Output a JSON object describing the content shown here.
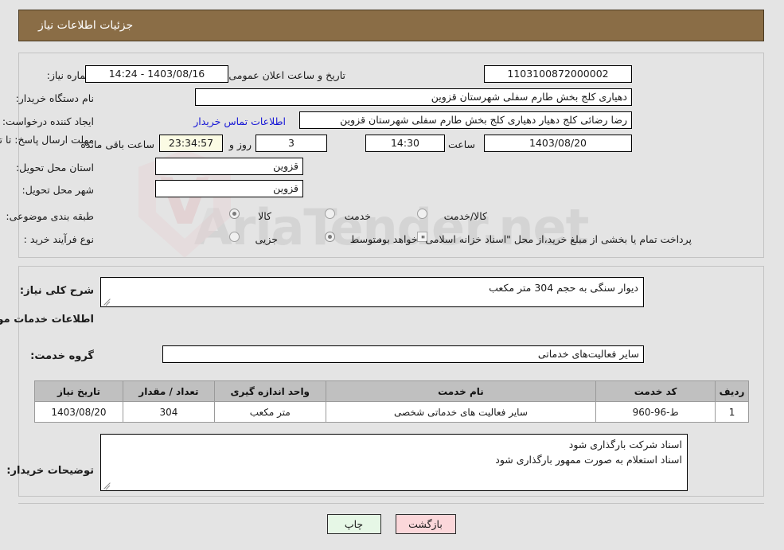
{
  "header": {
    "title": "جزئیات اطلاعات نیاز"
  },
  "watermark": {
    "text": "AriaTender.net"
  },
  "top_section": {
    "need_number": {
      "label": "شماره نیاز:",
      "value": "1103100872000002"
    },
    "public_announcement": {
      "label": "تاریخ و ساعت اعلان عمومی:",
      "value": "1403/08/16 - 14:24"
    },
    "buyer_org": {
      "label": "نام دستگاه خریدار:",
      "value": "دهیاری کلج بخش طارم سفلی شهرستان قزوین"
    },
    "creator": {
      "label": "ایجاد کننده درخواست:",
      "value": "رضا رضائی کلج دهیار دهیاری کلج بخش طارم سفلی شهرستان قزوین"
    },
    "contact_link": "اطلاعات تماس خریدار",
    "deadline": {
      "label": "مهلت ارسال پاسخ: تا تاریخ:",
      "date": "1403/08/20",
      "hour_label": "ساعت",
      "hour": "14:30",
      "days": "3",
      "days_label": "روز و",
      "countdown": "23:34:57",
      "countdown_label": "ساعت باقی مانده"
    },
    "delivery_province": {
      "label": "استان محل تحویل:",
      "value": "قزوین"
    },
    "delivery_city": {
      "label": "شهر محل تحویل:",
      "value": "قزوین"
    },
    "category": {
      "label": "طبقه بندی موضوعی:",
      "options": [
        "کالا",
        "خدمت",
        "کالا/خدمت"
      ],
      "selected": "خدمت"
    },
    "purchase_type": {
      "label": "نوع فرآیند خرید :",
      "options": [
        "جزیی",
        "متوسط"
      ],
      "selected": "متوسط",
      "treasury_note": "پرداخت تمام یا بخشی از مبلغ خرید،از محل \"اسناد خزانه اسلامی\" خواهد بود.",
      "treasury_checked": false
    }
  },
  "middle_section": {
    "general_description": {
      "label": "شرح کلی نیاز:",
      "value": "دیوار سنگی به حجم 304 متر مکعب"
    },
    "services_heading": "اطلاعات خدمات مورد نیاز",
    "service_group": {
      "label": "گروه خدمت:",
      "value": "سایر فعالیت‌های خدماتی"
    },
    "table": {
      "columns": [
        "ردیف",
        "کد خدمت",
        "نام خدمت",
        "واحد اندازه گیری",
        "تعداد / مقدار",
        "تاریخ نیاز"
      ],
      "rows": [
        {
          "row_no": "1",
          "service_code": "ط-96-960",
          "service_name": "سایر فعالیت های خدماتی شخصی",
          "unit": "متر مکعب",
          "quantity": "304",
          "need_date": "1403/08/20"
        }
      ]
    },
    "buyer_notes": {
      "label": "توضیحات خریدار:",
      "line1": "اسناد شرکت بارگذاری شود",
      "line2": "اسناد استعلام به صورت ممهور بارگذاری شود"
    }
  },
  "footer": {
    "print_button": "چاپ",
    "back_button": "بازگشت"
  },
  "colors": {
    "header_bg": "#8a6d46",
    "page_bg": "#e4e4e4",
    "link": "#1717d6",
    "table_header_bg": "#c0c0c0",
    "print_btn_bg": "#e6f7e6",
    "back_btn_bg": "#fbd7da",
    "countdown_bg": "#fbfbe4"
  }
}
